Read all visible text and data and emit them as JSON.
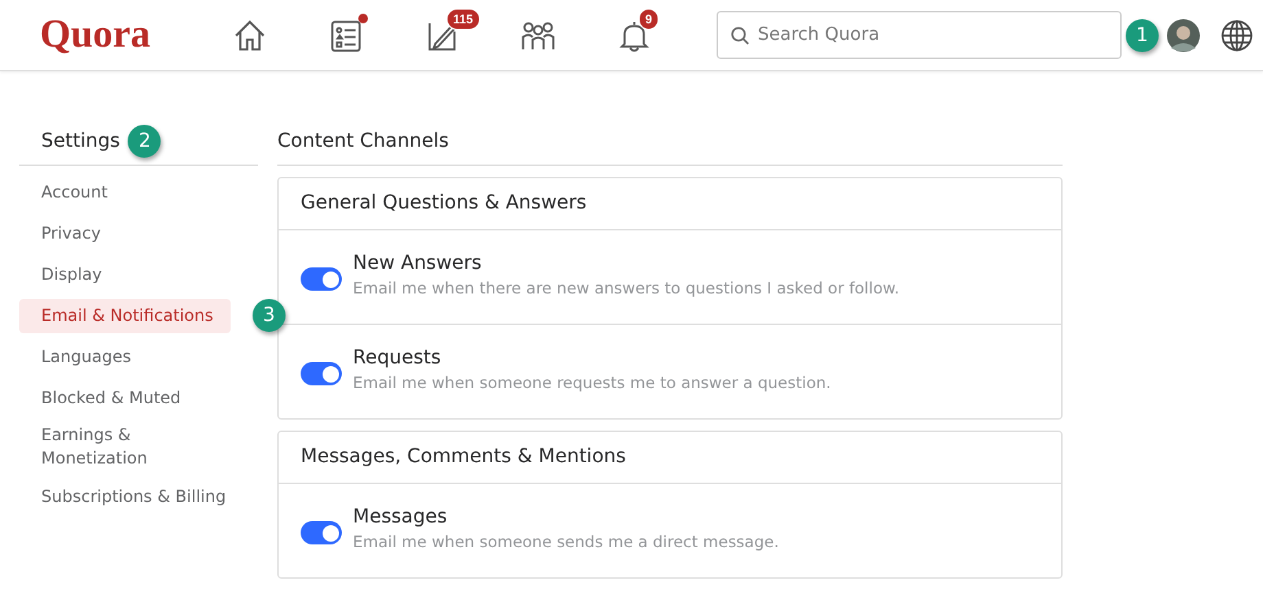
{
  "header": {
    "logo": "Quora",
    "nav": [
      {
        "kind": "home"
      },
      {
        "kind": "list",
        "dot": true
      },
      {
        "kind": "pencil",
        "badge": "115"
      },
      {
        "kind": "people"
      },
      {
        "kind": "bell",
        "badge": "9"
      }
    ],
    "search": {
      "placeholder": "Search Quora"
    },
    "callout": "1"
  },
  "sidebar": {
    "title": "Settings",
    "callout": "2",
    "items": [
      {
        "label": "Account",
        "selected": false
      },
      {
        "label": "Privacy",
        "selected": false
      },
      {
        "label": "Display",
        "selected": false
      },
      {
        "label": "Email & Notifications",
        "selected": true,
        "callout": "3"
      },
      {
        "label": "Languages",
        "selected": false
      },
      {
        "label": "Blocked & Muted",
        "selected": false
      },
      {
        "label": "Earnings & Monetization",
        "selected": false
      },
      {
        "label": "Subscriptions & Billing",
        "selected": false
      }
    ]
  },
  "content": {
    "title": "Content Channels",
    "sections": [
      {
        "title": "General Questions & Answers",
        "rows": [
          {
            "name": "New Answers",
            "description": "Email me when there are new answers to questions I asked or follow.",
            "on": true
          },
          {
            "name": "Requests",
            "description": "Email me when someone requests me to answer a question.",
            "on": true
          }
        ]
      },
      {
        "title": "Messages, Comments & Mentions",
        "rows": [
          {
            "name": "Messages",
            "description": "Email me when someone sends me a direct message.",
            "on": true
          }
        ]
      }
    ]
  }
}
